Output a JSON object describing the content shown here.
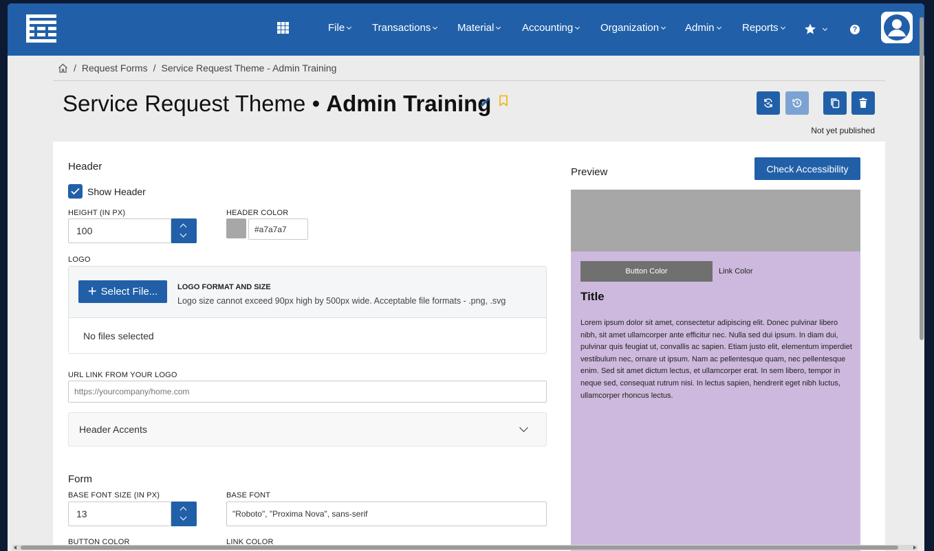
{
  "nav": {
    "items": [
      "File",
      "Transactions",
      "Material",
      "Accounting",
      "Organization",
      "Admin",
      "Reports"
    ],
    "star_icon": "star-icon",
    "help_icon": "help-icon",
    "help_glyph": "?"
  },
  "breadcrumb": {
    "home_icon": "home-icon",
    "separator": "/",
    "items": [
      "Request Forms",
      "Service Request Theme - Admin Training"
    ]
  },
  "title": {
    "prefix": "Service Request Theme • ",
    "name": "Admin Training"
  },
  "actions": {
    "icons": [
      "sync-icon",
      "history-icon",
      "copy-icon",
      "delete-icon"
    ],
    "status": "Not yet published"
  },
  "header_section": {
    "title": "Header",
    "show_header_label": "Show Header",
    "show_header_checked": true,
    "height_label": "HEIGHT (IN PX)",
    "height_value": "100",
    "header_color_label": "HEADER COLOR",
    "header_color_value": "#a7a7a7",
    "logo_label": "LOGO",
    "select_file_label": "Select File...",
    "logo_format_title": "LOGO FORMAT AND SIZE",
    "logo_format_desc": "Logo size cannot exceed 90px high by 500px wide. Acceptable file formats - .png, .svg",
    "no_files": "No files selected",
    "url_label": "URL LINK FROM YOUR LOGO",
    "url_placeholder": "https://yourcompany/home.com",
    "accents_label": "Header Accents"
  },
  "form_section": {
    "title": "Form",
    "base_font_size_label": "BASE FONT SIZE (IN PX)",
    "base_font_size_value": "13",
    "base_font_label": "BASE FONT",
    "base_font_value": "\"Roboto\", \"Proxima Nova\", sans-serif",
    "button_color_label": "BUTTON COLOR",
    "link_color_label": "LINK COLOR"
  },
  "preview": {
    "label": "Preview",
    "check_button": "Check Accessibility",
    "button_label": "Button Color",
    "link_label": "Link Color",
    "title": "Title",
    "body": "Lorem ipsum dolor sit amet, consectetur adipiscing elit. Donec pulvinar libero nibh, sit amet ullamcorper ante efficitur nec. Nulla sed dui ipsum. In diam dui, pulvinar quis feugiat ut, convallis ac sapien. Etiam justo elit, elementum imperdiet vestibulum nec, ornare ut ipsum. Nam ac pellentesque quam, nec pellentesque enim. Sed sit amet dictum lectus, et ullamcorper erat. In sem libero, tempor in neque sed, consequat rutrum nisi. In lectus sapien, hendrerit eget nibh luctus, ullamcorper rhoncus lectus.",
    "header_color": "#a7a7a7",
    "body_color": "#cdb9dd",
    "button_color": "#707070"
  },
  "colors": {
    "brand": "#2160a8",
    "brand_light": "#7ca3d3",
    "bookmark": "#f0b400"
  }
}
